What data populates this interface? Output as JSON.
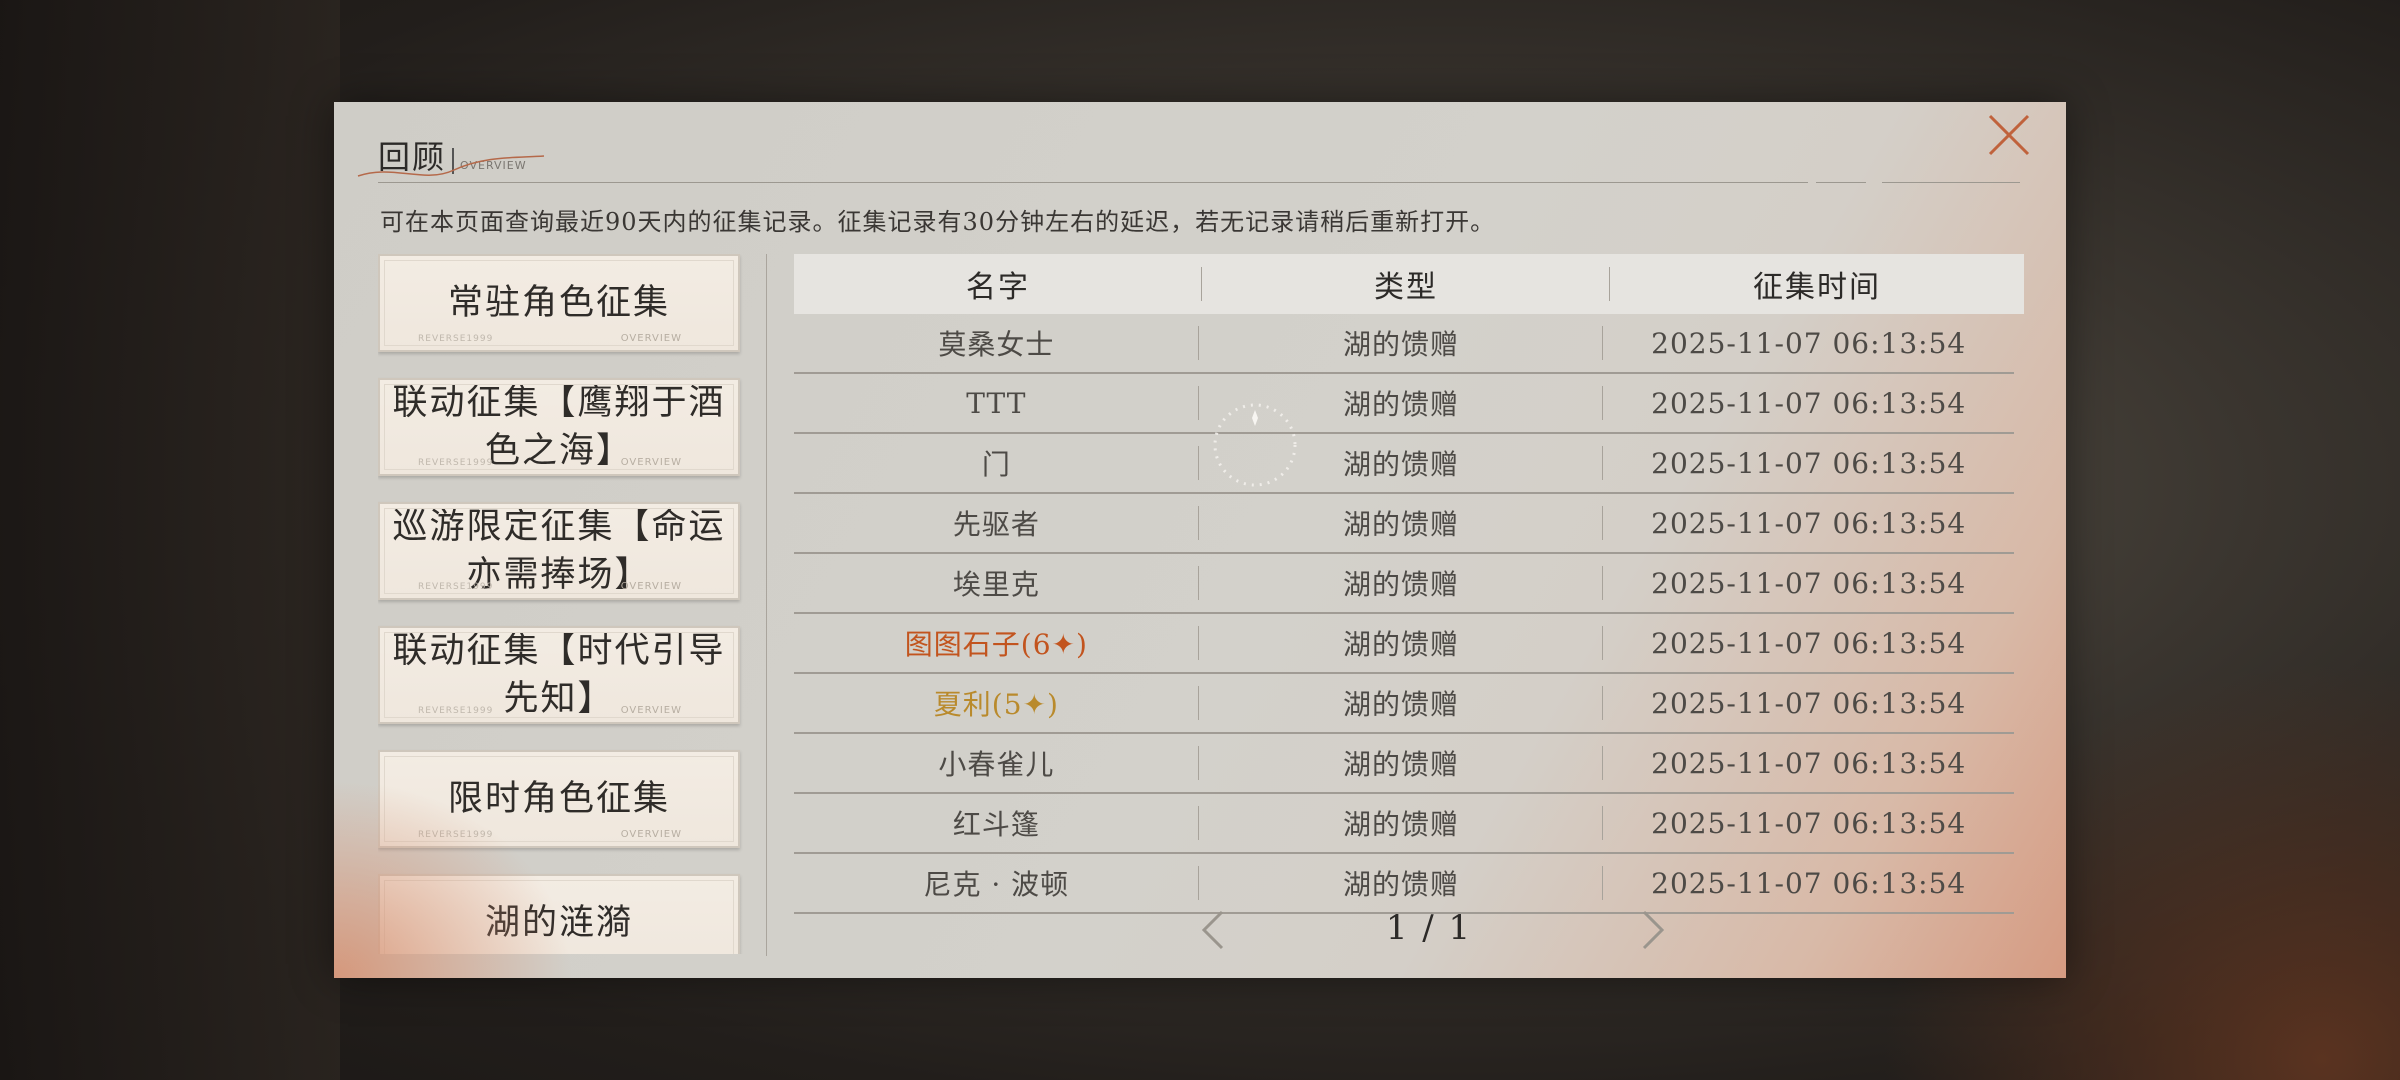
{
  "dialog": {
    "title": "回顾",
    "subtitle": "OVERVIEW",
    "description": "可在本页面查询最近90天内的征集记录。征集记录有30分钟左右的延迟，若无记录请稍后重新打开。"
  },
  "sidebar": {
    "items": [
      {
        "label": "常驻角色征集",
        "mini": "OVERVIEW",
        "mini_left": "REVERSE1999"
      },
      {
        "label": "联动征集【鹰翔于酒色之海】",
        "mini": "OVERVIEW",
        "mini_left": "REVERSE1999"
      },
      {
        "label": "巡游限定征集【命运亦需捧场】",
        "mini": "OVERVIEW",
        "mini_left": "REVERSE1999"
      },
      {
        "label": "联动征集【时代引导先知】",
        "mini": "OVERVIEW",
        "mini_left": "REVERSE1999"
      },
      {
        "label": "限时角色征集",
        "mini": "OVERVIEW",
        "mini_left": "REVERSE1999"
      },
      {
        "label": "湖的涟漪",
        "mini": "",
        "mini_left": ""
      }
    ]
  },
  "table": {
    "headers": [
      "名字",
      "类型",
      "征集时间"
    ],
    "rows": [
      {
        "name": "莫桑女士",
        "type": "湖的馈赠",
        "time": "2025-11-07 06:13:54",
        "rarity": "normal"
      },
      {
        "name": "TTT",
        "type": "湖的馈赠",
        "time": "2025-11-07 06:13:54",
        "rarity": "normal"
      },
      {
        "name": "门",
        "type": "湖的馈赠",
        "time": "2025-11-07 06:13:54",
        "rarity": "normal"
      },
      {
        "name": "先驱者",
        "type": "湖的馈赠",
        "time": "2025-11-07 06:13:54",
        "rarity": "normal"
      },
      {
        "name": "埃里克",
        "type": "湖的馈赠",
        "time": "2025-11-07 06:13:54",
        "rarity": "normal"
      },
      {
        "name": "图图石子(6✦)",
        "type": "湖的馈赠",
        "time": "2025-11-07 06:13:54",
        "rarity": "six"
      },
      {
        "name": "夏利(5✦)",
        "type": "湖的馈赠",
        "time": "2025-11-07 06:13:54",
        "rarity": "five"
      },
      {
        "name": "小春雀儿",
        "type": "湖的馈赠",
        "time": "2025-11-07 06:13:54",
        "rarity": "normal"
      },
      {
        "name": "红斗篷",
        "type": "湖的馈赠",
        "time": "2025-11-07 06:13:54",
        "rarity": "normal"
      },
      {
        "name": "尼克 · 波顿",
        "type": "湖的馈赠",
        "time": "2025-11-07 06:13:54",
        "rarity": "normal"
      }
    ]
  },
  "pagination": {
    "text": "1 / 1"
  },
  "colors": {
    "six_star": "#c2541e",
    "five_star": "#b98a2c",
    "close_icon": "#c0623c"
  }
}
